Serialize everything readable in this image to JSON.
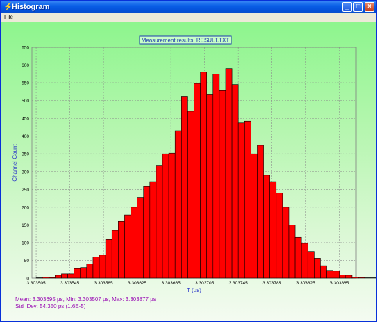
{
  "window": {
    "title": "Histogram",
    "icon": "lightning-icon",
    "controls": [
      "minimize-button",
      "maximize-button",
      "close-button"
    ]
  },
  "menu": {
    "items": [
      "File"
    ]
  },
  "chart_data": {
    "type": "bar",
    "title": "Measurement results: RESULT.TXT",
    "xlabel": "T (µs)",
    "ylabel": "Channel Count",
    "ylim": [
      0,
      650
    ],
    "yticks": [
      0,
      50,
      100,
      150,
      200,
      250,
      300,
      350,
      400,
      450,
      500,
      550,
      600,
      650
    ],
    "xlim": [
      3.3035,
      3.303885
    ],
    "xticks": [
      "3.303505",
      "3.303545",
      "3.303585",
      "3.303625",
      "3.303665",
      "3.303705",
      "3.303745",
      "3.303785",
      "3.303825",
      "3.303865"
    ],
    "bin_start": 3.303505,
    "bin_width": 7.5e-06,
    "values": [
      1,
      3,
      2,
      8,
      12,
      12,
      27,
      30,
      40,
      60,
      65,
      109,
      135,
      160,
      178,
      200,
      228,
      258,
      272,
      318,
      350,
      352,
      415,
      512,
      470,
      548,
      580,
      518,
      575,
      528,
      590,
      545,
      437,
      442,
      350,
      374,
      290,
      272,
      240,
      200,
      150,
      115,
      98,
      75,
      56,
      35,
      22,
      20,
      9,
      8,
      3,
      2,
      1,
      1
    ],
    "bar_color": "#ff0000",
    "grid": true
  },
  "stats": {
    "line1": "Mean: 3.303695 µs, Min: 3.303507 µs, Max: 3.303877 µs",
    "line2": "Std_Dev: 54.350 ps  (1.6E-5)"
  }
}
